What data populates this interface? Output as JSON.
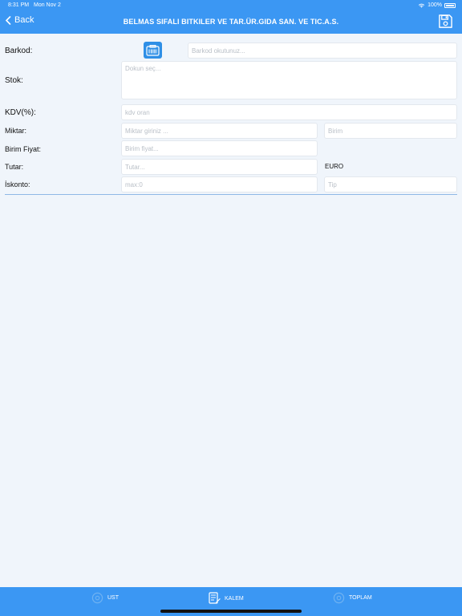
{
  "status_bar": {
    "time": "8:31 PM",
    "date": "Mon Nov 2",
    "battery": "100%"
  },
  "header": {
    "back_label": "Back",
    "title": "BELMAS SIFALI BITKILER VE TAR.ÜR.GIDA SAN. VE TIC.A.S."
  },
  "form": {
    "barkod": {
      "label": "Barkod:",
      "placeholder": "Barkod okutunuz..."
    },
    "stok": {
      "label": "Stok:",
      "placeholder": "Dokun seç..."
    },
    "kdv": {
      "label": "KDV(%):",
      "placeholder": "kdv oran"
    },
    "miktar": {
      "label": "Miktar:",
      "placeholder": "Miktar giriniz ...",
      "unit_placeholder": "Birim"
    },
    "birim_fiyat": {
      "label": "Birim Fiyat:",
      "placeholder": "Birim fiyat..."
    },
    "tutar": {
      "label": "Tutar:",
      "placeholder": "Tutar...",
      "currency": "EURO"
    },
    "iskonto": {
      "label": "İskonto:",
      "placeholder": "max:0",
      "type_placeholder": "Tip"
    }
  },
  "tabs": [
    {
      "label": "UST",
      "icon": "gear-icon"
    },
    {
      "label": "KALEM",
      "icon": "edit-document-icon"
    },
    {
      "label": "TOPLAM",
      "icon": "gear-icon"
    }
  ],
  "colors": {
    "accent": "#3b97f3",
    "background": "#f0f5fb",
    "scan_button": "#2f8fe6"
  }
}
